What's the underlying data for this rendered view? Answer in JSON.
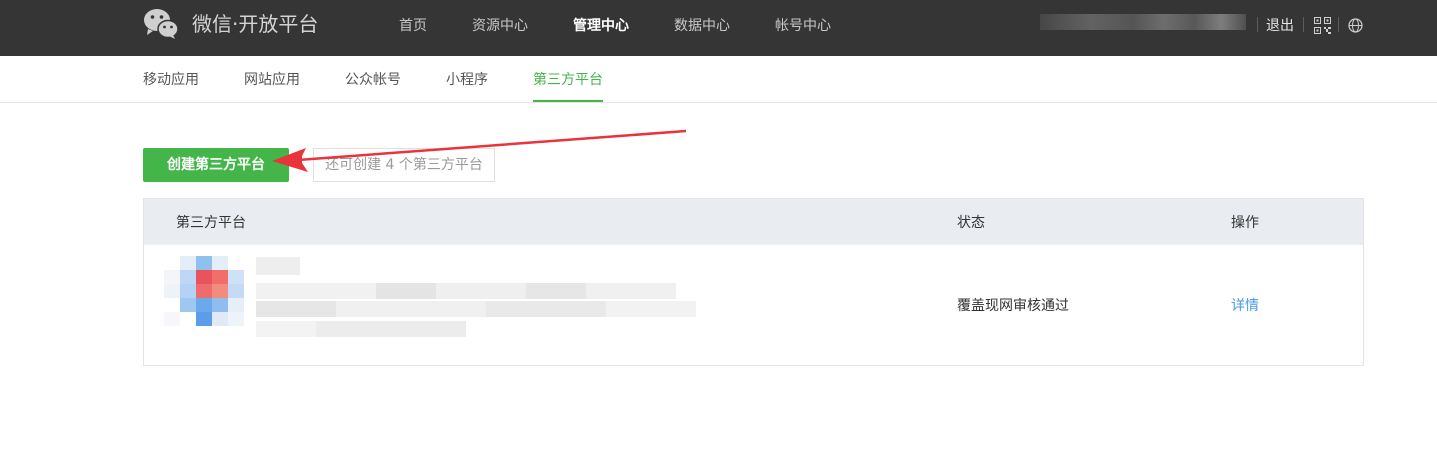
{
  "header": {
    "brand": "微信·开放平台",
    "nav": [
      {
        "label": "首页"
      },
      {
        "label": "资源中心"
      },
      {
        "label": "管理中心",
        "active": true
      },
      {
        "label": "数据中心"
      },
      {
        "label": "帐号中心"
      }
    ],
    "logout_label": "退出",
    "icons": [
      "wechat-logo-icon",
      "qrcode-icon",
      "globe-icon"
    ]
  },
  "subnav": {
    "items": [
      {
        "label": "移动应用"
      },
      {
        "label": "网站应用"
      },
      {
        "label": "公众帐号"
      },
      {
        "label": "小程序"
      },
      {
        "label": "第三方平台",
        "active": true
      }
    ]
  },
  "actions": {
    "create_label": "创建第三方平台",
    "quota_tip": "还可创建 4 个第三方平台"
  },
  "table": {
    "columns": [
      "第三方平台",
      "状态",
      "操作"
    ],
    "rows": [
      {
        "status": "覆盖现网审核通过",
        "action": "详情"
      }
    ]
  },
  "colors": {
    "topbar": "#353535",
    "accent_green": "#44b549",
    "link_blue": "#459ae9",
    "table_header": "#e9edf1",
    "annotation_red": "#e8343a"
  }
}
